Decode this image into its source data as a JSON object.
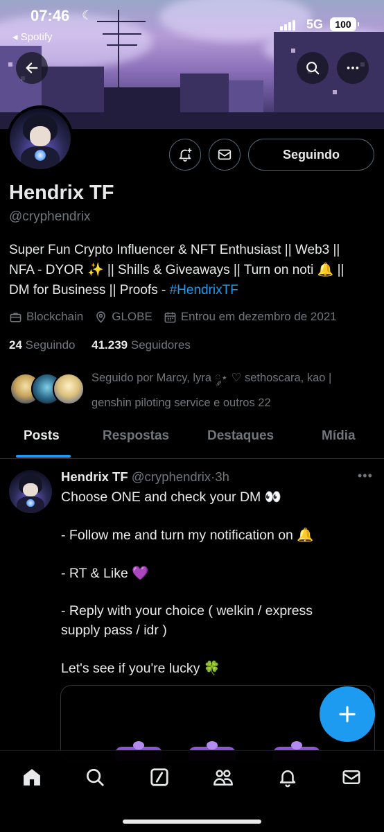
{
  "status_bar": {
    "time": "07:46",
    "back_app": "◂ Spotify",
    "network": "5G",
    "battery": "100"
  },
  "profile": {
    "name": "Hendrix TF",
    "handle": "@cryphendrix",
    "follow_button": "Seguindo",
    "bio": {
      "line1": "Super Fun Crypto Influencer & NFT Enthusiast || Web3 ||",
      "line2": "NFA - DYOR ✨ || Shills & Giveaways || Turn on noti 🔔 ||",
      "line3_prefix": "DM for Business || Proofs - ",
      "hashtag": "#HendrixTF"
    },
    "category": "Blockchain",
    "location": "GLOBE",
    "joined": "Entrou em dezembro de 2021",
    "following_count": "24",
    "following_label": "Seguindo",
    "followers_count": "41.239",
    "followers_label": "Seguidores",
    "followed_by_line1": "Seguido por Marcy, lyra ༘⋆ ♡ sethoscara, kao |",
    "followed_by_line2": "genshin piloting service e outros 22"
  },
  "tabs": [
    {
      "label": "Posts",
      "active": true
    },
    {
      "label": "Respostas",
      "active": false
    },
    {
      "label": "Destaques",
      "active": false
    },
    {
      "label": "Mídia",
      "active": false
    }
  ],
  "post": {
    "author_name": "Hendrix TF",
    "author_handle": "@cryphendrix",
    "separator": "·",
    "time": "3h",
    "lines": [
      "Choose ONE and check your DM 👀",
      "- Follow me and turn my notification on 🔔",
      "- RT & Like 💜",
      "- Reply with your choice ( welkin / express",
      "supply pass / idr )",
      "Let's see if you're lucky 🍀"
    ]
  },
  "colors": {
    "accent": "#1d9bf0",
    "text_primary": "#e7e9ea",
    "text_secondary": "#71767b",
    "border": "#2f3336",
    "background": "#000000"
  },
  "icons": {
    "back": "arrow-left-icon",
    "search": "search-icon",
    "more": "more-horizontal-icon",
    "notify": "bell-plus-icon",
    "message": "envelope-icon",
    "compose": "plus-icon",
    "nav": [
      "home-icon",
      "search-icon",
      "grok-icon",
      "communities-icon",
      "bell-icon",
      "envelope-icon"
    ]
  }
}
